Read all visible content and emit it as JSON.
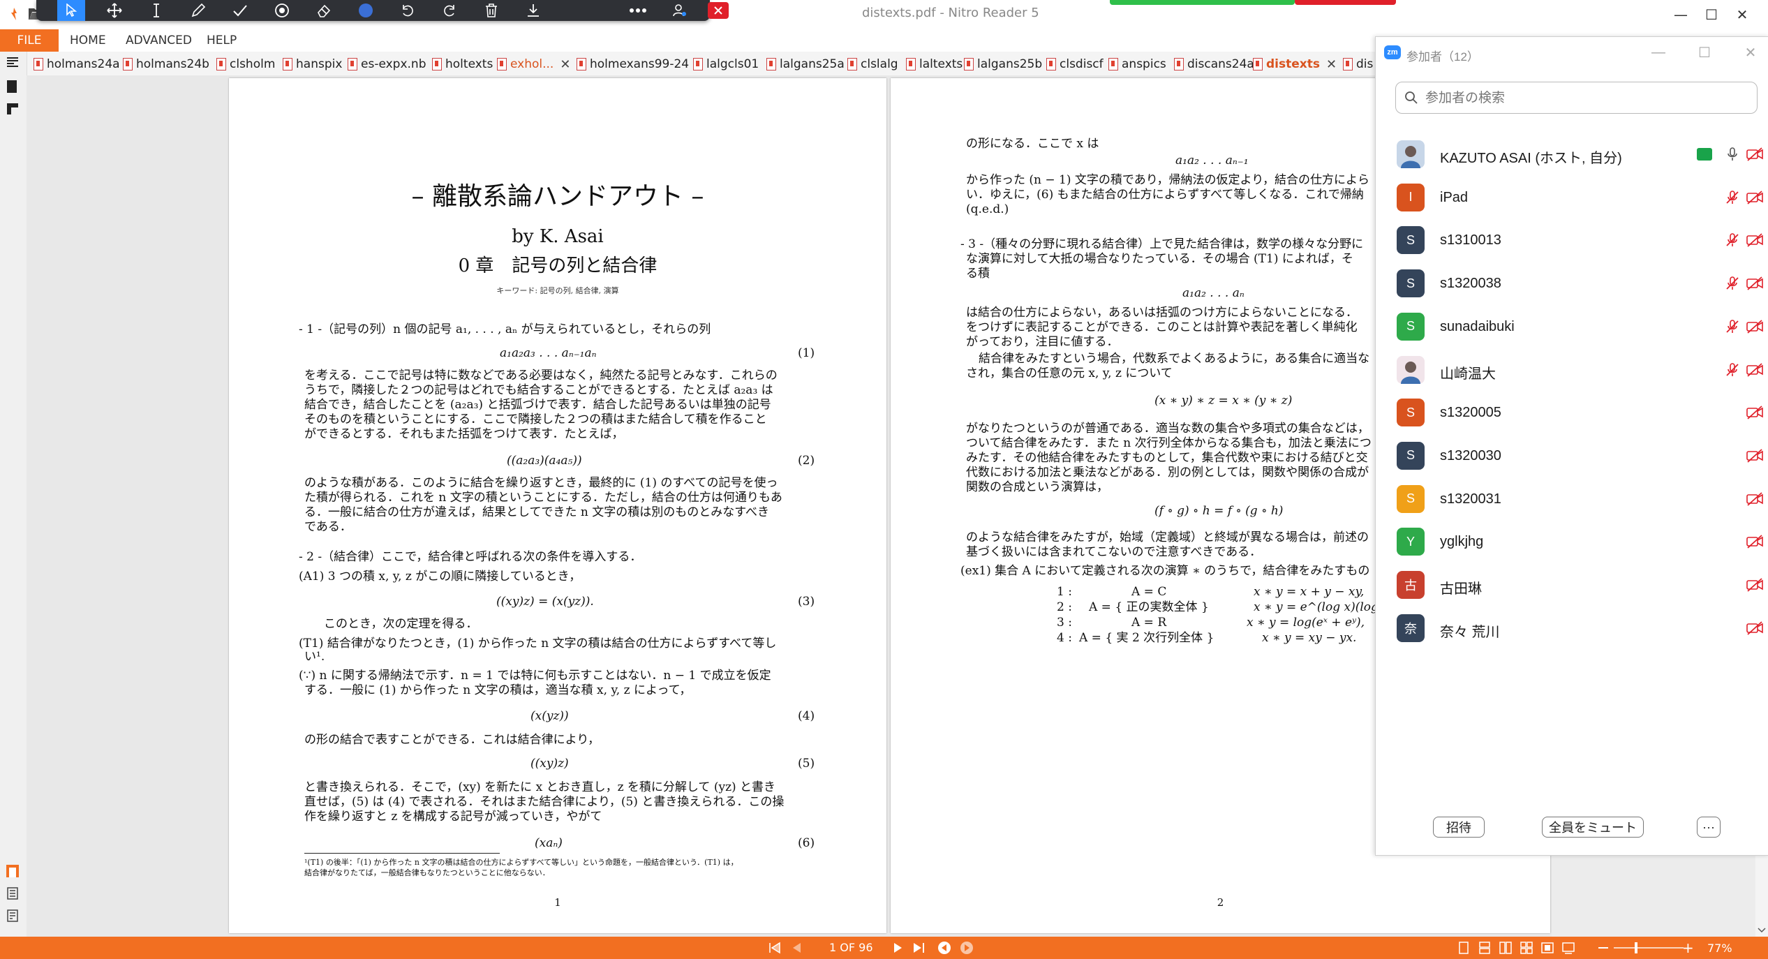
{
  "window": {
    "title": "distexts.pdf - Nitro Reader 5"
  },
  "menu": {
    "file": "FILE",
    "items": [
      "HOME",
      "ADVANCED",
      "HELP"
    ]
  },
  "tabs": [
    {
      "label": "holmans24a"
    },
    {
      "label": "holmans24b"
    },
    {
      "label": "clsholm"
    },
    {
      "label": "hanspix"
    },
    {
      "label": "es-expx.nb"
    },
    {
      "label": "holtexts"
    },
    {
      "label": "exhol..."
    },
    {
      "label": "holmexans99-24"
    },
    {
      "label": "lalgcls01"
    },
    {
      "label": "lalgans25a"
    },
    {
      "label": "clslalg"
    },
    {
      "label": "laltexts"
    },
    {
      "label": "lalgans25b"
    },
    {
      "label": "clsdiscf"
    },
    {
      "label": "anspics"
    },
    {
      "label": "discans24a"
    },
    {
      "label": "distexts"
    },
    {
      "label": "dis"
    }
  ],
  "page1": {
    "title": "– 離散系論ハンドアウト –",
    "author": "by K. Asai",
    "chapter": "0 章　記号の列と結合律",
    "keywords": "キーワード: 記号の列, 結合律, 演算",
    "s1_head": "- 1 -（記号の列）n 個の記号 a₁, . . . , aₙ が与えられているとし，それらの列",
    "eq1": "a₁a₂a₃ . . . aₙ₋₁aₙ",
    "eq1n": "(1)",
    "para1": [
      "を考える．ここで記号は特に数などである必要はなく，純然たる記号とみなす．これらの",
      "うちで，隣接した２つの記号はどれでも結合することができるとする．たとえば a₂a₃ は",
      "結合でき，結合したことを (a₂a₃) と括弧づけで表す．結合した記号あるいは単独の記号",
      "そのものを積ということにする．ここで隣接した２つの積はまた結合して積を作ること",
      "ができるとする．それもまた括弧をつけて表す．たとえば，"
    ],
    "eq2": "((a₂a₃)(a₄a₅))",
    "eq2n": "(2)",
    "para2": [
      "のような積がある．このように結合を繰り返すとき，最終的に (1) のすべての記号を使っ",
      "た積が得られる．これを n 文字の積ということにする．ただし，結合の仕方は何通りもあ",
      "る．一般に結合の仕方が違えば，結果としてできた n 文字の積は別のものとみなすべき",
      "である．"
    ],
    "s2_head": "- 2 -（結合律）ここで，結合律と呼ばれる次の条件を導入する．",
    "a1": "(A1) 3 つの積 x, y, z がこの順に隣接しているとき，",
    "eq3": "((xy)z) = (x(yz)).",
    "eq3n": "(3)",
    "theorem_intro": "このとき，次の定理を得る．",
    "t1": [
      "(T1) 結合律がなりたつとき，(1) から作った n 文字の積は結合の仕方によらずすべて等し",
      "い¹."
    ],
    "proof": [
      "(∵) n に関する帰納法で示す．n = 1 では特に何も示すことはない．n − 1 で成立を仮定",
      "する．一般に (1) から作った n 文字の積は，適当な積 x, y, z によって，"
    ],
    "eq4": "(x(yz))",
    "eq4n": "(4)",
    "para4": "の形の結合で表すことができる．これは結合律により，",
    "eq5": "((xy)z)",
    "eq5n": "(5)",
    "para5": [
      "と書き換えられる．そこで，(xy) を新たに x とおき直し，z を積に分解して (yz) と書き",
      "直せば，(5) は (4) で表される．それはまた結合律により，(5) と書き換えられる．この操",
      "作を繰り返すと z を構成する記号が減っていき，やがて"
    ],
    "eq6": "(xaₙ)",
    "eq6n": "(6)",
    "footnote": [
      "¹(T1) の後半：「(1) から作った n 文字の積は結合の仕方によらずすべて等しい」という命題を，一般結合律という．(T1) は，",
      "結合律がなりたてば，一般結合律もなりたつということに他ならない．"
    ],
    "page_no": "1"
  },
  "page2": {
    "l1": "の形になる．ここで x は",
    "eq_a": "a₁a₂ . . . aₙ₋₁",
    "para_a": [
      "から作った (n − 1) 文字の積であり，帰納法の仮定より，結合の仕方によら",
      "い．ゆえに，(6) もまた結合の仕方によらずすべて等しくなる．これで帰納",
      "(q.e.d.)"
    ],
    "s3_head": [
      "- 3 -（種々の分野に現れる結合律）上で見た結合律は，数学の様々な分野に",
      "な演算に対して大抵の場合なりたっている．その場合 (T1) によれば，そ",
      "る積"
    ],
    "eq_b": "a₁a₂ . . . aₙ",
    "para_b": [
      "は結合の仕方によらない，あるいは括弧のつけ方によらないことになる．",
      "をつけずに表記することができる．このことは計算や表記を著しく単純化",
      "がっており，注目に値する．"
    ],
    "para_c": [
      "結合律をみたすという場合，代数系でよくあるように，ある集合に適当な",
      "され，集合の任意の元 x, y, z について"
    ],
    "eq_c": "(x ∗ y) ∗ z = x ∗ (y ∗ z)",
    "para_d": [
      "がなりたつというのが普通である．適当な数の集合や多項式の集合などは，",
      "ついて結合律をみたす．また n 次行列全体からなる集合も，加法と乗法につ",
      "みたす．その他結合律をみたすものとして，集合代数や束における結びと交",
      "代数における加法と乗法などがある．別の例としては，関数や関係の合成が",
      "関数の合成という演算は，"
    ],
    "eq_d": "(f ∘ g) ∘ h = f ∘ (g ∘ h)",
    "para_e": [
      "のような結合律をみたすが，始域（定義域）と終域が異なる場合は，前述の",
      "基づく扱いには含まれてこないので注意すべきである．"
    ],
    "ex1": "(ex1) 集合 A において定義される次の演算 ∗ のうちで，結合律をみたすもの",
    "ex_rows": [
      {
        "n": "1 :",
        "set": "A = C",
        "op": "x ∗ y = x + y − xy,"
      },
      {
        "n": "2 :",
        "set": "A = { 正の実数全体 }",
        "op": "x ∗ y = e^(log x)(log y),"
      },
      {
        "n": "3 :",
        "set": "A = R",
        "op": "x ∗ y = log(eˣ + eʸ),"
      },
      {
        "n": "4 :",
        "set": "A = { 実 2 次行列全体 }",
        "op": "x ∗ y = xy − yx."
      }
    ],
    "page_no": "2"
  },
  "zoom": {
    "title": "参加者（12）",
    "logo": "zm",
    "search_placeholder": "参加者の検索",
    "participants": [
      {
        "name": "KAZUTO ASAI (ホスト, 自分)",
        "initial": "",
        "color": "#c7d6e8",
        "photo": true,
        "share": true,
        "mic_muted": false,
        "cam_off": true
      },
      {
        "name": "iPad",
        "initial": "I",
        "color": "#d9531e",
        "mic_muted": true,
        "cam_off": true
      },
      {
        "name": "s1310013",
        "initial": "S",
        "color": "#34445a",
        "mic_muted": true,
        "cam_off": true
      },
      {
        "name": "s1320038",
        "initial": "S",
        "color": "#34445a",
        "mic_muted": true,
        "cam_off": true
      },
      {
        "name": "sunadaibuki",
        "initial": "S",
        "color": "#2eaa4a",
        "mic_muted": true,
        "cam_off": true
      },
      {
        "name": "山崎温大",
        "initial": "",
        "color": "#f1e4ea",
        "photo": true,
        "mic_muted": true,
        "cam_off": true
      },
      {
        "name": "s1320005",
        "initial": "S",
        "color": "#d9531e",
        "cam_off": true
      },
      {
        "name": "s1320030",
        "initial": "S",
        "color": "#34445a",
        "cam_off": true
      },
      {
        "name": "s1320031",
        "initial": "S",
        "color": "#f0a018",
        "cam_off": true
      },
      {
        "name": "yglkjhg",
        "initial": "Y",
        "color": "#2eaa4a",
        "cam_off": true
      },
      {
        "name": "古田琳",
        "initial": "古",
        "color": "#c8402e",
        "cam_off": true
      },
      {
        "name": "奈々 荒川",
        "initial": "奈",
        "color": "#34445a",
        "cam_off": true
      }
    ],
    "invite": "招待",
    "mute_all": "全員をミュート",
    "more": "···"
  },
  "status": {
    "page_indicator": "1 OF 96",
    "zoom": "77%"
  },
  "colors": {
    "accent": "#f26f21",
    "zoom_blue": "#2d8cff",
    "muted_red": "#e0202a"
  }
}
